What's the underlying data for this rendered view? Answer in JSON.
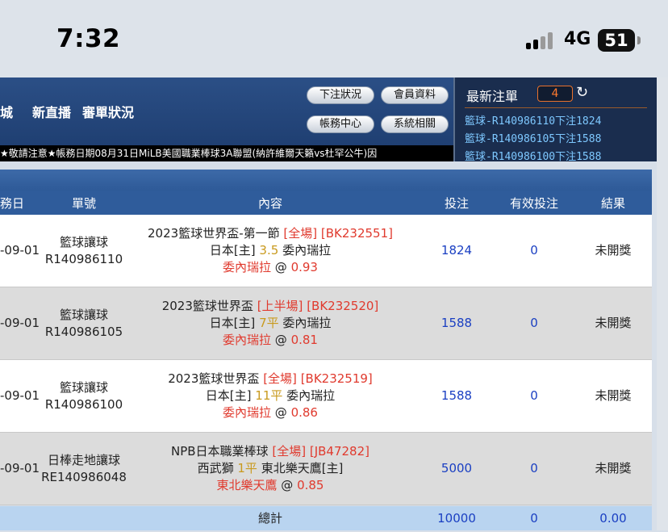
{
  "status_bar": {
    "time": "7:32",
    "network": "4G",
    "battery": "51"
  },
  "nav": {
    "link_partial": "城",
    "link_live": "新直播",
    "link_review": "審單狀況"
  },
  "buttons": {
    "bet_status": "下注狀況",
    "member_info": "會員資料",
    "account_center": "帳務中心",
    "system": "系統相關"
  },
  "ticker": "★敬請注意★帳務日期08月31日MiLB美國職業棒球3A聯盟(納許維爾天籟vs杜罕公牛)因",
  "latest": {
    "title": "最新注單",
    "count": "4",
    "items": [
      "籃球-R140986110下注1824",
      "籃球-R140986105下注1588",
      "籃球-R140986100下注1588"
    ]
  },
  "table": {
    "headers": {
      "date": "務日期",
      "order": "單號",
      "content": "內容",
      "bet": "投注",
      "valid_bet": "有效投注",
      "result": "結果"
    },
    "rows": [
      {
        "date": "-09-01",
        "type": "籃球讓球",
        "order_no": "R140986110",
        "league": "2023籃球世界盃-第一節",
        "period": "[全場]",
        "code": "[BK232551]",
        "home": "日本[主]",
        "line": "3.5",
        "away": "委內瑞拉",
        "pick": "委內瑞拉",
        "at": "@",
        "odds": "0.93",
        "bet": "1824",
        "valid": "0",
        "result": "未開獎"
      },
      {
        "date": "-09-01",
        "type": "籃球讓球",
        "order_no": "R140986105",
        "league": "2023籃球世界盃",
        "period": "[上半場]",
        "code": "[BK232520]",
        "home": "日本[主]",
        "line": "7平",
        "away": "委內瑞拉",
        "pick": "委內瑞拉",
        "at": "@",
        "odds": "0.81",
        "bet": "1588",
        "valid": "0",
        "result": "未開獎"
      },
      {
        "date": "-09-01",
        "type": "籃球讓球",
        "order_no": "R140986100",
        "league": "2023籃球世界盃",
        "period": "[全場]",
        "code": "[BK232519]",
        "home": "日本[主]",
        "line": "11平",
        "away": "委內瑞拉",
        "pick": "委內瑞拉",
        "at": "@",
        "odds": "0.86",
        "bet": "1588",
        "valid": "0",
        "result": "未開獎"
      },
      {
        "date": "-09-01",
        "type": "日棒走地讓球",
        "order_no": "RE140986048",
        "league": "NPB日本職業棒球",
        "period": "[全場]",
        "code": "[JB47282]",
        "home": "西武獅",
        "line": "1平",
        "away": "東北樂天鷹[主]",
        "pick": "東北樂天鷹",
        "at": "@",
        "odds": "0.85",
        "bet": "5000",
        "valid": "0",
        "result": "未開獎"
      }
    ],
    "total": {
      "label": "總計",
      "bet": "10000",
      "valid": "0",
      "result": "0.00"
    }
  }
}
